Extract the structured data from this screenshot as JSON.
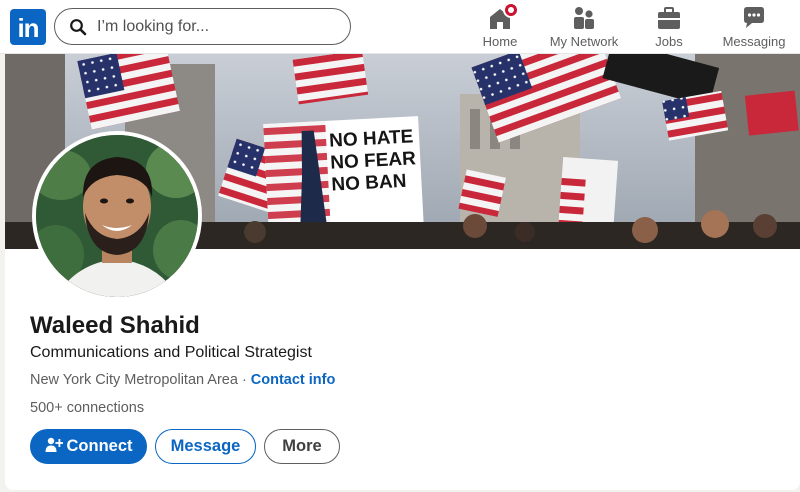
{
  "brand": {
    "logo_text": "in",
    "accent": "#0a66c2"
  },
  "search": {
    "placeholder": "I’m looking for..."
  },
  "nav": {
    "items": [
      {
        "label": "Home",
        "icon": "home-icon",
        "has_badge": true
      },
      {
        "label": "My Network",
        "icon": "network-icon"
      },
      {
        "label": "Jobs",
        "icon": "briefcase-icon"
      },
      {
        "label": "Messaging",
        "icon": "messaging-icon"
      }
    ]
  },
  "banner": {
    "sign_lines": [
      "NO HATE",
      "NO FEAR",
      "NO BAN"
    ]
  },
  "profile": {
    "name": "Waleed Shahid",
    "headline": "Communications and Political Strategist",
    "location": "New York City Metropolitan Area",
    "separator": "·",
    "contact_link": "Contact info",
    "connections": "500+ connections"
  },
  "actions": {
    "connect": "Connect",
    "message": "Message",
    "more": "More"
  },
  "colors": {
    "primary": "#0a66c2",
    "badge": "#cb112d",
    "text_secondary": "#5e5e5e"
  }
}
